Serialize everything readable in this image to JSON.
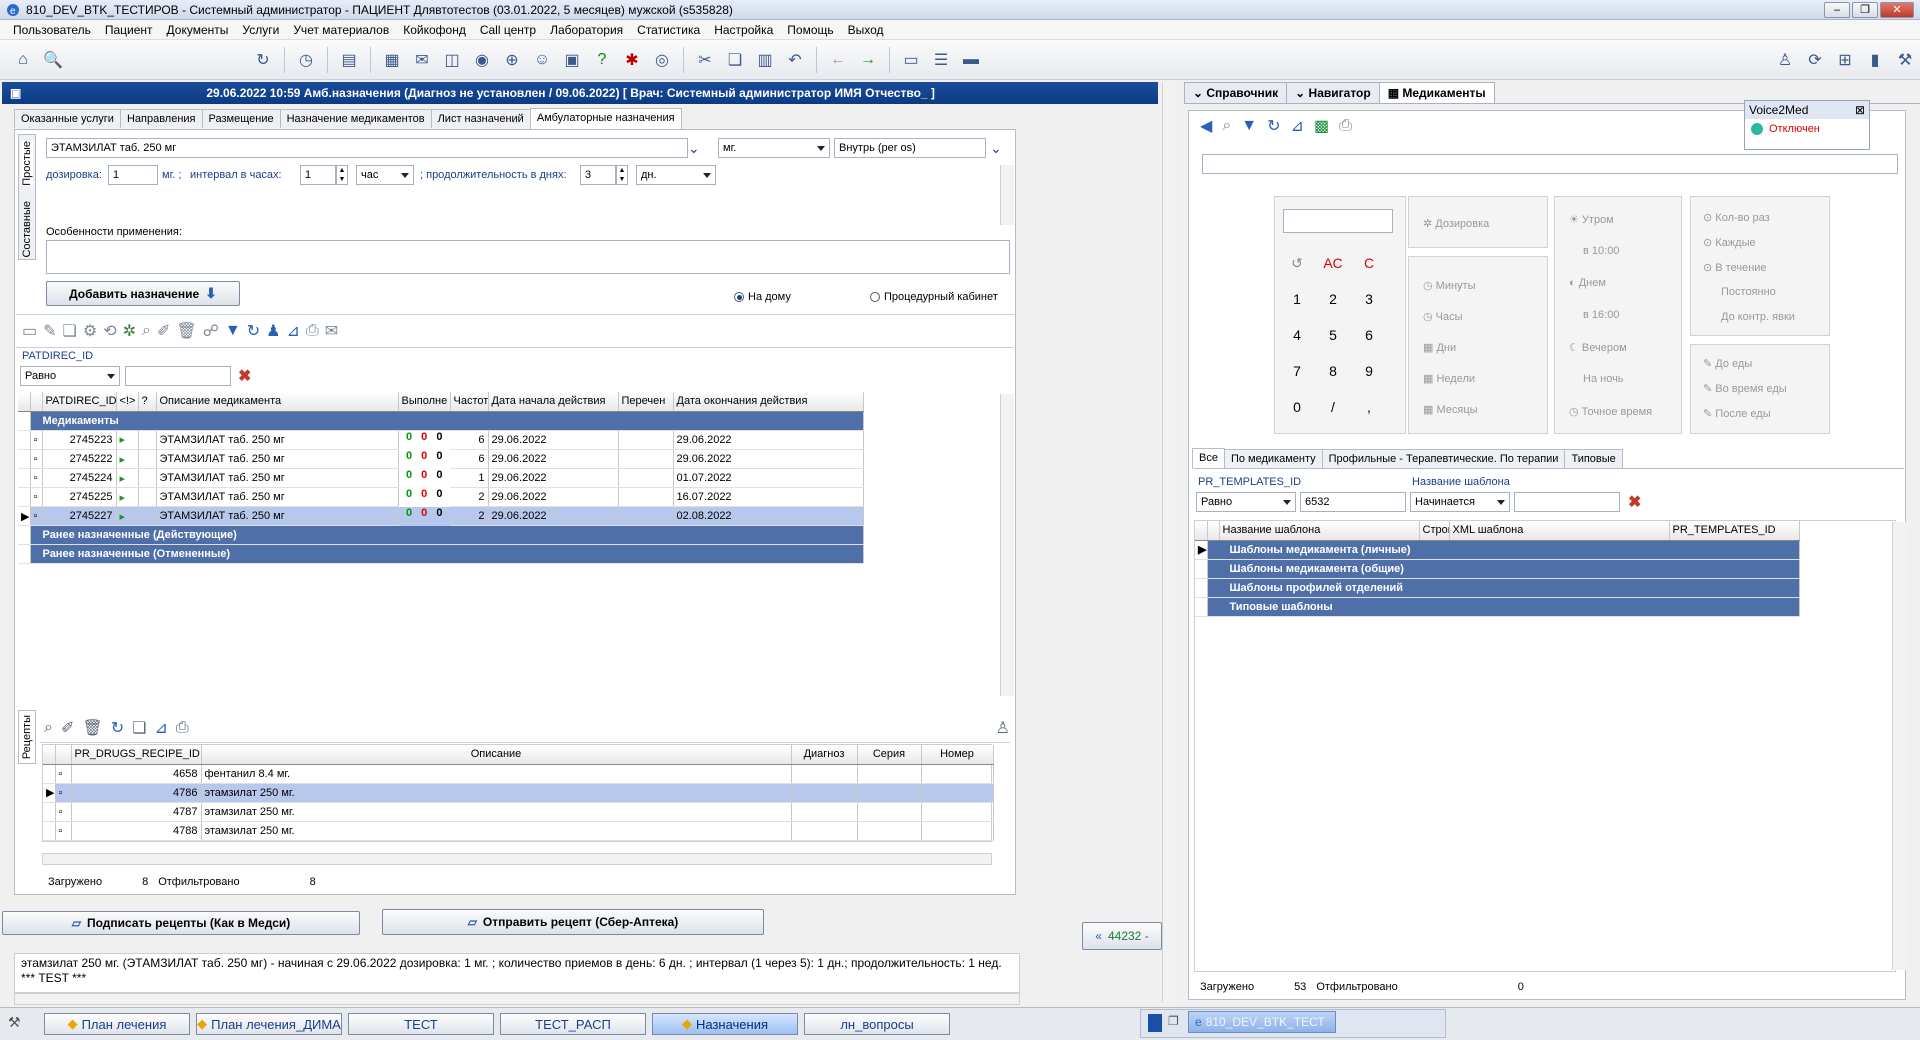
{
  "window": {
    "title": "810_DEV_BTK_ТЕСТИРОВ - Системный администратор - ПАЦИЕНТ Длявтотестов  (03.01.2022,  5 месяцев) мужской (s535828)"
  },
  "menu": [
    "Пользователь",
    "Пациент",
    "Документы",
    "Услуги",
    "Учет материалов",
    "Койкофонд",
    "Call центр",
    "Лаборатория",
    "Статистика",
    "Настройка",
    "Помощь",
    "Выход"
  ],
  "left": {
    "header": "29.06.2022 10:59  Амб.назначения (Диагноз не установлен / 09.06.2022)  [ Врач: Системный администратор ИМЯ Отчество_ ]",
    "tabs": [
      "Оказанные услуги",
      "Направления",
      "Размещение",
      "Назначение медикаментов",
      "Лист назначений",
      "Амбулаторные назначения"
    ],
    "side_tabs": [
      "Простые",
      "Составные"
    ],
    "form": {
      "drug": "ЭТАМЗИЛАТ таб. 250 мг",
      "unit": "мг.",
      "route": "Внутрь (per os)",
      "dose_label": "дозировка:",
      "dose": "1",
      "dose_unit": "мг. ;",
      "interval_label": "интервал в часах:",
      "interval": "1",
      "interval_unit": "час",
      "duration_label": "; продолжительность в днях:",
      "duration": "3",
      "duration_unit": "дн.",
      "features_label": "Особенности применения:",
      "add_button": "Добавить назначение",
      "radio_home": "На дому",
      "radio_proc": "Процедурный кабинет"
    },
    "filter": {
      "label": "PATDIREC_ID",
      "op": "Равно",
      "value": ""
    },
    "grid": {
      "columns": [
        "PATDIREC_ID",
        "<!>",
        "?",
        "Описание медикамента",
        "Выполне",
        "Частот",
        "Дата начала действия",
        "Перечен",
        "Дата окончания действия"
      ],
      "group_main": "Медикаменты",
      "rows": [
        {
          "id": "2745223",
          "desc": "ЭТАМЗИЛАТ таб. 250 мг",
          "a": "0",
          "b": "0",
          "c": "0",
          "freq": "6",
          "start": "29.06.2022",
          "end": "29.06.2022"
        },
        {
          "id": "2745222",
          "desc": "ЭТАМЗИЛАТ таб. 250 мг",
          "a": "0",
          "b": "0",
          "c": "0",
          "freq": "6",
          "start": "29.06.2022",
          "end": "29.06.2022"
        },
        {
          "id": "2745224",
          "desc": "ЭТАМЗИЛАТ таб. 250 мг",
          "a": "0",
          "b": "0",
          "c": "0",
          "freq": "1",
          "start": "29.06.2022",
          "end": "01.07.2022"
        },
        {
          "id": "2745225",
          "desc": "ЭТАМЗИЛАТ таб. 250 мг",
          "a": "0",
          "b": "0",
          "c": "0",
          "freq": "2",
          "start": "29.06.2022",
          "end": "16.07.2022"
        },
        {
          "id": "2745227",
          "desc": "ЭТАМЗИЛАТ таб. 250 мг",
          "a": "0",
          "b": "0",
          "c": "0",
          "freq": "2",
          "start": "29.06.2022",
          "end": "02.08.2022"
        }
      ],
      "group_active": "Ранее назначенные (Действующие)",
      "group_cancelled": "Ранее назначенные (Отмененные)"
    },
    "recipes": {
      "side_tab": "Рецепты",
      "columns": [
        "PR_DRUGS_RECIPE_ID",
        "Описание",
        "Диагноз",
        "Серия",
        "Номер"
      ],
      "rows": [
        {
          "id": "4658",
          "desc": "фентанил 8.4 мг."
        },
        {
          "id": "4786",
          "desc": "этамзилат 250 мг."
        },
        {
          "id": "4787",
          "desc": "этамзилат 250 мг."
        },
        {
          "id": "4788",
          "desc": "этамзилат 250 мг."
        }
      ],
      "loaded_label": "Загружено",
      "loaded": "8",
      "filtered_label": "Отфильтровано",
      "filtered": "8"
    },
    "sign_button": "Подписать рецепты (Как в Медси)",
    "send_button": "Отправить рецепт (Сбер-Аптека)",
    "side_button": "44232 -",
    "description": "этамзилат 250 мг. (ЭТАМЗИЛАТ таб. 250 мг) - начиная с 29.06.2022 дозировка: 1 мг. ; количество приемов в день: 6 дн. ; интервал (1 через 5): 1 дн.; продолжительность: 1 нед. *** TEST ***"
  },
  "right": {
    "tabs": [
      "Справочник",
      "Навигатор",
      "Медикаменты"
    ],
    "voice": {
      "title": "Voice2Med",
      "status": "Отключен"
    },
    "calc": {
      "keys": [
        "АС",
        "С",
        "1",
        "2",
        "3",
        "4",
        "5",
        "6",
        "7",
        "8",
        "9",
        "0",
        "/",
        ","
      ],
      "dosage": "Дозировка",
      "units": [
        "Минуты",
        "Часы",
        "Дни",
        "Недели",
        "Месяцы"
      ],
      "times": [
        "Утром",
        "в 10:00",
        "Днем",
        "в 16:00",
        "Вечером",
        "На ночь",
        "Точное время"
      ],
      "freq": [
        "Кол-во раз",
        "Каждые",
        "В течение",
        "Постоянно",
        "До контр. явки"
      ],
      "meal": [
        "До еды",
        "Во время еды",
        "После еды"
      ]
    },
    "tmpl_tabs": [
      "Все",
      "По медикаменту",
      "Профильные - Терапевтические. По терапии",
      "Типовые"
    ],
    "filter": {
      "id_label": "PR_TEMPLATES_ID",
      "op": "Равно",
      "value": "6532",
      "name_label": "Название шаблона",
      "name_op": "Начинается",
      "name_value": ""
    },
    "grid": {
      "columns": [
        "Название шаблона",
        "Строк",
        "XML шаблона",
        "PR_TEMPLATES_ID"
      ],
      "groups": [
        "Шаблоны медикамента (личные)",
        "Шаблоны медикамента (общие)",
        "Шаблоны профилей отделений",
        "Типовые шаблоны"
      ]
    },
    "loaded_label": "Загружено",
    "loaded": "53",
    "filtered_label": "Отфильтровано",
    "filtered": "0"
  },
  "taskbar": [
    {
      "label": "План лечения",
      "active": false
    },
    {
      "label": "План лечения_ДИМА",
      "active": false
    },
    {
      "label": "ТЕСТ",
      "active": false
    },
    {
      "label": "ТЕСТ_РАСП",
      "active": false
    },
    {
      "label": "Назначения",
      "active": true
    },
    {
      "label": "лн_вопросы",
      "active": false
    }
  ],
  "taskbar_app": "810_DEV_BTK_ТЕСТ"
}
